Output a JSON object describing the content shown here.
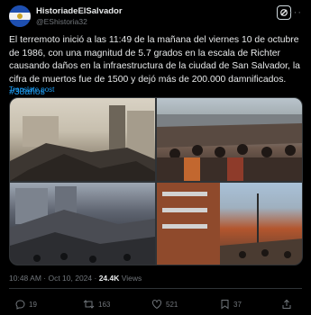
{
  "author": {
    "name": "HistoriadeElSalvador",
    "handle": "@EShistoria32"
  },
  "post": {
    "text": "El terremoto inició a las 11:49 de la mañana del viernes 10 de octubre de 1986, con una magnitud de 5.7 grados en la escala de Richter causando daños en la infraestructura de la ciudad de San Salvador, la cifra de muertos fue de 1500 y dejó más de 200.000 damnificados. ",
    "hashtag": "#38años",
    "translate_label": "Translate post"
  },
  "meta": {
    "time": "10:48 AM · Oct 10, 2024 · ",
    "views": "24.4K",
    "views_label": " Views"
  },
  "actions": {
    "replies": "19",
    "reposts": "163",
    "likes": "521",
    "bookmarks": "37"
  },
  "icons": [
    "grok-icon",
    "more-icon",
    "reply-icon",
    "repost-icon",
    "like-icon",
    "bookmark-icon",
    "share-icon"
  ]
}
